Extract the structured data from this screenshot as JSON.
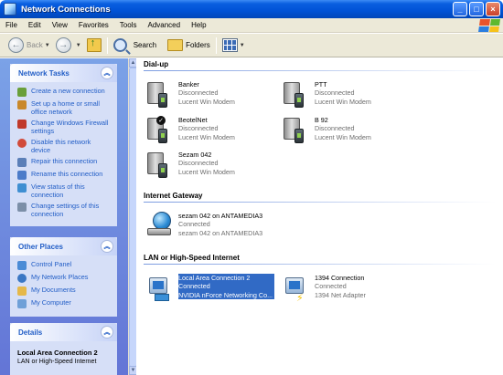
{
  "window": {
    "title": "Network Connections"
  },
  "menu": [
    "File",
    "Edit",
    "View",
    "Favorites",
    "Tools",
    "Advanced",
    "Help"
  ],
  "toolbar": {
    "back": "Back",
    "search": "Search",
    "folders": "Folders"
  },
  "colors": {
    "titlebar": "#0052d6",
    "taskpane_bg": "#6f8de0",
    "task_link": "#215dc6",
    "selection": "#316ac5"
  },
  "left": {
    "network_tasks": {
      "title": "Network Tasks",
      "items": [
        {
          "label": "Create a new connection",
          "icon": "new-connection-icon"
        },
        {
          "label": "Set up a home or small office network",
          "icon": "home-network-icon"
        },
        {
          "label": "Change Windows Firewall settings",
          "icon": "firewall-icon"
        },
        {
          "label": "Disable this network device",
          "icon": "disable-device-icon"
        },
        {
          "label": "Repair this connection",
          "icon": "repair-icon"
        },
        {
          "label": "Rename this connection",
          "icon": "rename-icon"
        },
        {
          "label": "View status of this connection",
          "icon": "status-icon"
        },
        {
          "label": "Change settings of this connection",
          "icon": "settings-icon"
        }
      ]
    },
    "other_places": {
      "title": "Other Places",
      "items": [
        {
          "label": "Control Panel",
          "icon": "control-panel-icon"
        },
        {
          "label": "My Network Places",
          "icon": "network-places-icon"
        },
        {
          "label": "My Documents",
          "icon": "documents-icon"
        },
        {
          "label": "My Computer",
          "icon": "computer-icon"
        }
      ]
    },
    "details": {
      "title": "Details",
      "name": "Local Area Connection 2",
      "type": "LAN or High-Speed Internet"
    }
  },
  "groups": {
    "dialup": {
      "title": "Dial-up",
      "items": [
        {
          "name": "Banker",
          "status": "Disconnected",
          "device": "Lucent Win Modem"
        },
        {
          "name": "PTT",
          "status": "Disconnected",
          "device": "Lucent Win Modem"
        },
        {
          "name": "BeotelNet",
          "status": "Disconnected",
          "device": "Lucent Win Modem"
        },
        {
          "name": "B 92",
          "status": "Disconnected",
          "device": "Lucent Win Modem"
        },
        {
          "name": "Sezam 042",
          "status": "Disconnected",
          "device": "Lucent Win Modem"
        }
      ]
    },
    "gateway": {
      "title": "Internet Gateway",
      "items": [
        {
          "name": "sezam 042 on ANTAMEDIA3",
          "status": "Connected",
          "device": "sezam 042 on ANTAMEDIA3"
        }
      ]
    },
    "lan": {
      "title": "LAN or High-Speed Internet",
      "items": [
        {
          "name": "Local Area Connection 2",
          "status": "Connected",
          "device": "NVIDIA nForce Networking Co..."
        },
        {
          "name": "1394 Connection",
          "status": "Connected",
          "device": "1394 Net Adapter"
        }
      ]
    }
  }
}
